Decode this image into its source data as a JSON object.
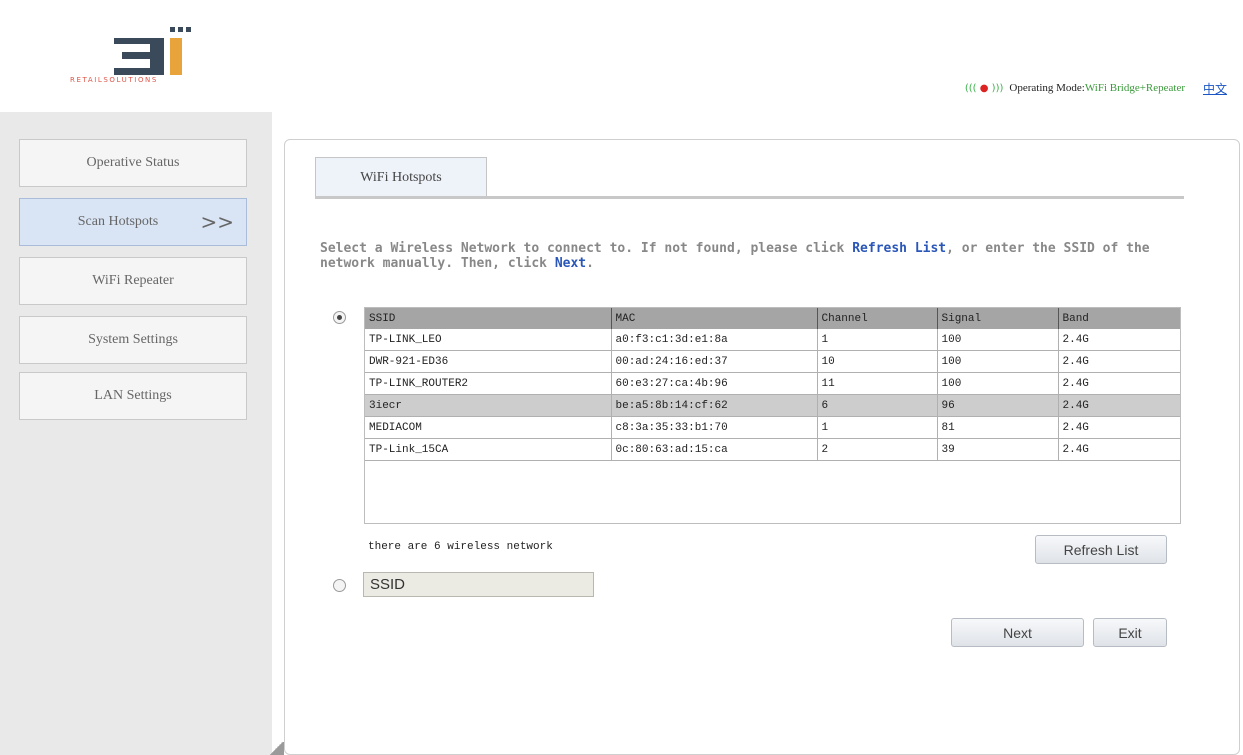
{
  "header": {
    "logo_text": "RETAILSOLUTIONS",
    "mode_label": "Operating Mode:",
    "mode_value": "WiFi Bridge+Repeater",
    "language_link": "中文"
  },
  "sidebar": {
    "items": [
      {
        "label": "Operative Status"
      },
      {
        "label": "Scan Hotspots",
        "active_marker": ">>"
      },
      {
        "label": "WiFi Repeater"
      },
      {
        "label": "System Settings"
      },
      {
        "label": "LAN Settings"
      }
    ]
  },
  "main": {
    "tab_label": "WiFi Hotspots",
    "instruction": {
      "part1": "Select a Wireless Network to connect to. If not found, please click ",
      "refresh_word": "Refresh List",
      "part2": ", or enter the SSID of the network manually. Then, click ",
      "next_word": "Next",
      "part3": "."
    },
    "table": {
      "headers": [
        "SSID",
        "MAC",
        "Channel",
        "Signal",
        "Band"
      ],
      "rows": [
        [
          "TP-LINK_LEO",
          "a0:f3:c1:3d:e1:8a",
          "1",
          "100",
          "2.4G"
        ],
        [
          "DWR-921-ED36",
          "00:ad:24:16:ed:37",
          "10",
          "100",
          "2.4G"
        ],
        [
          "TP-LINK_ROUTER2",
          "60:e3:27:ca:4b:96",
          "11",
          "100",
          "2.4G"
        ],
        [
          "3iecr",
          "be:a5:8b:14:cf:62",
          "6",
          "96",
          "2.4G"
        ],
        [
          "MEDIACOM",
          "c8:3a:35:33:b1:70",
          "1",
          "81",
          "2.4G"
        ],
        [
          "TP-Link_15CA",
          "0c:80:63:ad:15:ca",
          "2",
          "39",
          "2.4G"
        ]
      ],
      "selected_row": 3
    },
    "count_text": "there are 6 wireless network",
    "refresh_button": "Refresh List",
    "ssid_input_value": "SSID",
    "next_button": "Next",
    "exit_button": "Exit"
  },
  "colors": {
    "accent_blue": "#2a56b8",
    "logo_red": "#e0554a",
    "mode_green": "#3a9a3a"
  }
}
